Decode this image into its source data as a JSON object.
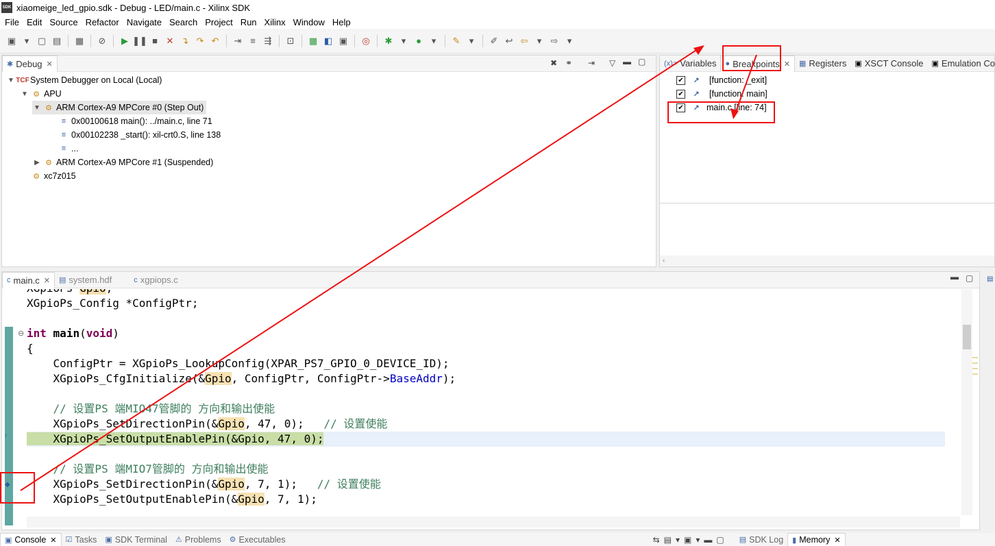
{
  "window": {
    "title": "xiaomeige_led_gpio.sdk - Debug - LED/main.c - Xilinx SDK",
    "app_icon": "SDK"
  },
  "menu": [
    "File",
    "Edit",
    "Source",
    "Refactor",
    "Navigate",
    "Search",
    "Project",
    "Run",
    "Xilinx",
    "Window",
    "Help"
  ],
  "debug_view": {
    "tab_label": "Debug",
    "tree": [
      {
        "label": "System Debugger on Local (Local)"
      },
      {
        "label": "APU"
      },
      {
        "label": "ARM Cortex-A9 MPCore #0 (Step Out)"
      },
      {
        "label": "0x00100618 main(): ../main.c, line 71"
      },
      {
        "label": "0x00102238 _start(): xil-crt0.S, line 138"
      },
      {
        "label": "..."
      },
      {
        "label": "ARM Cortex-A9 MPCore #1 (Suspended)"
      },
      {
        "label": "xc7z015"
      }
    ]
  },
  "right_view": {
    "tabs": [
      "Variables",
      "Breakpoints",
      "Registers",
      "XSCT Console",
      "Emulation Co"
    ],
    "breakpoints": [
      {
        "label": "[function: _exit]",
        "checked": true
      },
      {
        "label": "[function: main]",
        "checked": true
      },
      {
        "label": "main.c [line: 74]",
        "checked": true
      }
    ]
  },
  "editor": {
    "tabs": [
      "main.c",
      "system.hdf",
      "xgpiops.c"
    ],
    "lines": [
      {
        "text": "XGpioPs Gpio;"
      },
      {
        "text": "XGpioPs_Config *ConfigPtr;"
      },
      {
        "text": ""
      },
      {
        "text": "int main(void)"
      },
      {
        "text": "{"
      },
      {
        "text": "    ConfigPtr = XGpioPs_LookupConfig(XPAR_PS7_GPIO_0_DEVICE_ID);"
      },
      {
        "text": "    XGpioPs_CfgInitialize(&Gpio, ConfigPtr, ConfigPtr->BaseAddr);"
      },
      {
        "text": ""
      },
      {
        "text": "    // 设置PS 端MIO47管脚的 方向和输出使能"
      },
      {
        "text": "    XGpioPs_SetDirectionPin(&Gpio, 47, 0);   // 设置使能"
      },
      {
        "text": "    XGpioPs_SetOutputEnablePin(&Gpio, 47, 0);"
      },
      {
        "text": ""
      },
      {
        "text": "    // 设置PS 端MIO7管脚的 方向和输出使能"
      },
      {
        "text": "    XGpioPs_SetDirectionPin(&Gpio, 7, 1);   // 设置使能"
      },
      {
        "text": "    XGpioPs_SetOutputEnablePin(&Gpio, 7, 1);"
      }
    ]
  },
  "bottom_tabs": [
    "Console",
    "Tasks",
    "SDK Terminal",
    "Problems",
    "Executables",
    "SDK Log",
    "Memory"
  ],
  "colors": {
    "annotation_red": "#ee1111",
    "keyword": "#7f0055",
    "comment": "#3f7f5f",
    "current_line": "#c9dea6"
  }
}
